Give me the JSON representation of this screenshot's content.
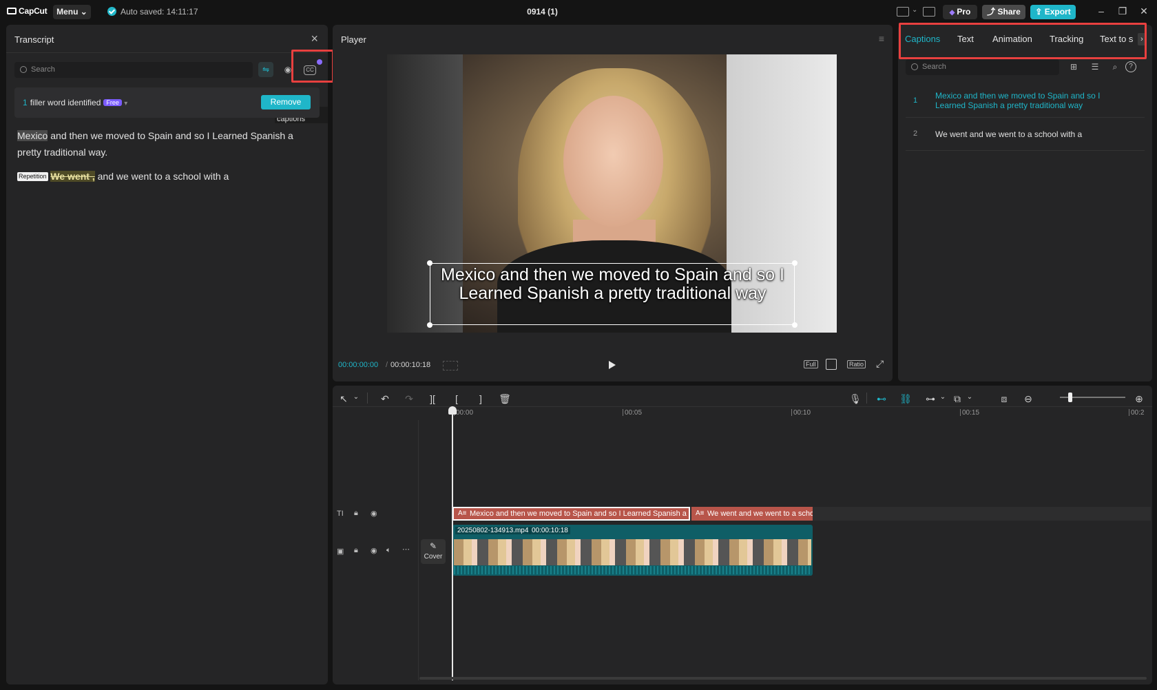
{
  "titlebar": {
    "app_name": "CapCut",
    "menu_label": "Menu",
    "autosave": "Auto saved: 14:11:17",
    "project_title": "0914 (1)",
    "pro_label": "Pro",
    "share_label": "Share",
    "export_label": "Export"
  },
  "transcript": {
    "title": "Transcript",
    "search_placeholder": "Search",
    "tooltip": "Generate captions",
    "filler_count": "1",
    "filler_text": "filler word identified",
    "free_tag": "Free",
    "remove_label": "Remove",
    "para1_highlight": "Mexico",
    "para1_rest": " and then we moved to Spain and so I Learned Spanish a pretty traditional way.",
    "rep_tag": "Repetition",
    "rep_words": "We went ,",
    "para2_rest": " and we went to a school with a"
  },
  "player": {
    "title": "Player",
    "caption": "Mexico and then we moved to Spain and so I Learned Spanish a pretty traditional way",
    "time_current": "00:00:00:00",
    "time_total": "00:00:10:18",
    "full_label": "Full",
    "ratio_label": "Ratio"
  },
  "props": {
    "tabs": [
      "Captions",
      "Text",
      "Animation",
      "Tracking",
      "Text to s"
    ],
    "search_placeholder": "Search",
    "captions": [
      {
        "num": "1",
        "text": "Mexico and then we moved to Spain and so I Learned Spanish a pretty traditional way"
      },
      {
        "num": "2",
        "text": "We went and we went to a school with a"
      }
    ]
  },
  "timeline": {
    "ruler": [
      "00:00",
      "00:05",
      "00:10",
      "00:15",
      "00:2"
    ],
    "clip1": "Mexico and then we moved to Spain and so I Learned Spanish a pretty traditional way",
    "clip2": "We went and we went to a school with a",
    "video_name": "20250802-134913.mp4",
    "video_duration": "00:00:10:18",
    "cover_label": "Cover"
  },
  "colors": {
    "accent": "#1fb6c9",
    "highlight_box": "#e8403f",
    "caption_clip": "#b8554a",
    "video_clip": "#0f5e66"
  }
}
